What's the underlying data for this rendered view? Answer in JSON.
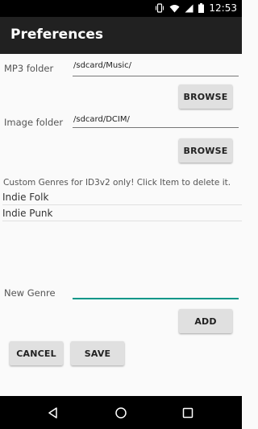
{
  "status_bar": {
    "time": "12:53",
    "icons": [
      "vibrate-icon",
      "wifi-icon",
      "signal-icon",
      "battery-icon"
    ]
  },
  "toolbar": {
    "title": "Preferences"
  },
  "mp3": {
    "label": "MP3 folder",
    "value": "/sdcard/Music/",
    "browse_label": "BROWSE"
  },
  "image": {
    "label": "Image folder",
    "value": "/sdcard/DCIM/",
    "browse_label": "BROWSE"
  },
  "genres": {
    "note": "Custom Genres for ID3v2 only! Click Item to delete it.",
    "items": [
      "Indie Folk",
      "Indie Punk"
    ]
  },
  "new_genre": {
    "label": "New Genre",
    "value": "",
    "add_label": "ADD"
  },
  "actions": {
    "cancel_label": "CANCEL",
    "save_label": "SAVE"
  },
  "nav": {
    "icons": [
      "back-icon",
      "home-icon",
      "recents-icon"
    ]
  },
  "colors": {
    "accent": "#009688",
    "toolbar": "#212121",
    "button": "#e0e0e0"
  }
}
